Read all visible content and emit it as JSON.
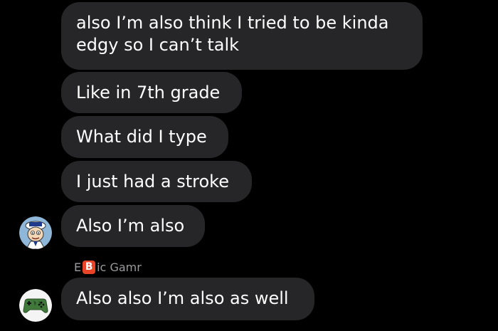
{
  "messages": [
    {
      "lines": [
        "also I’m also think I tried to be kinda",
        "edgy so I can’t talk"
      ]
    },
    {
      "text": "Like in 7th grade"
    },
    {
      "text": "What did I type"
    },
    {
      "text": "I just had a stroke"
    },
    {
      "text": "Also I’m also"
    },
    {
      "text": "Also also I’m also as well"
    }
  ],
  "sender_name": {
    "prefix": "E",
    "badge": "B",
    "suffix": "ic Gamr"
  },
  "avatars": [
    {
      "icon": "cartoon-character-avatar"
    },
    {
      "icon": "game-controller-avatar"
    }
  ],
  "colors": {
    "background": "#000000",
    "bubble": "#262628",
    "text": "#ffffff",
    "sender": "#9a9a9e",
    "badge": "#e8442a"
  }
}
